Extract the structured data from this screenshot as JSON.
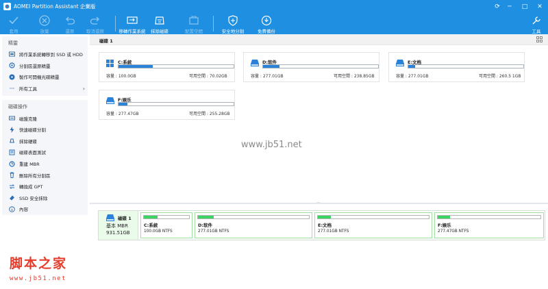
{
  "window": {
    "title": "AOMEI Partition Assistant 企業版"
  },
  "toolbar": {
    "apply": "套用",
    "discard": "放棄",
    "undo": "還原",
    "redo": "取消還原",
    "migrate": "移轉作業系統",
    "wipe": "抹除磁碟",
    "free_space": "配置空間",
    "secure_erase": "安全地分割",
    "free_backup": "免費備份",
    "tools": "工具"
  },
  "sidebar": {
    "wizards_title": "精靈",
    "wizards": [
      {
        "label": "將作業系統轉移到 SSD 或 HDD",
        "icon": "migrate-os-icon"
      },
      {
        "label": "分割區還原精靈",
        "icon": "partition-recovery-icon"
      },
      {
        "label": "製作可開機光碟精靈",
        "icon": "bootable-media-icon"
      },
      {
        "label": "所有工具",
        "icon": "more-icon"
      }
    ],
    "ops_title": "磁碟操作",
    "ops": [
      {
        "label": "磁盤克隆",
        "icon": "clone-disk-icon"
      },
      {
        "label": "快速磁碟分割",
        "icon": "quick-partition-icon"
      },
      {
        "label": "抹除硬碟",
        "icon": "wipe-disk-icon"
      },
      {
        "label": "磁碟表面測試",
        "icon": "surface-test-icon"
      },
      {
        "label": "重建 MBR",
        "icon": "rebuild-mbr-icon"
      },
      {
        "label": "刪除所有分割區",
        "icon": "delete-partitions-icon"
      },
      {
        "label": "轉換成 GPT",
        "icon": "convert-gpt-icon"
      },
      {
        "label": "SSD 安全抹除",
        "icon": "ssd-erase-icon"
      },
      {
        "label": "內容",
        "icon": "properties-icon"
      }
    ]
  },
  "disk": {
    "title": "磁碟 1",
    "type": "基本 MBR",
    "size": "931.51GB"
  },
  "partitions": [
    {
      "name": "C:系統",
      "capacity_label": "容量 : 100.0GB",
      "free_label": "可用空間 : 70.02GB",
      "used": 0.3,
      "map_size": "100.0GB NTFS"
    },
    {
      "name": "D:软件",
      "capacity_label": "容量 : 277.01GB",
      "free_label": "可用空間 : 238.85GB",
      "used": 0.14,
      "map_size": "277.01GB NTFS"
    },
    {
      "name": "E:文档",
      "capacity_label": "容量 : 277.01GB",
      "free_label": "可用空間 : 260.5 1GB",
      "used": 0.06,
      "map_size": "277.01GB NTFS"
    },
    {
      "name": "F:娱乐",
      "capacity_label": "容量 : 277.47GB",
      "free_label": "可用空間 : 255.28GB",
      "used": 0.08,
      "map_size": "277.47GB NTFS"
    }
  ],
  "watermark": "www.jb51.net",
  "logo": {
    "text": "脚本之家",
    "url": "www.jb51.net"
  },
  "colors": {
    "accent": "#1e8fe1",
    "bar_fill": "#2b82d9",
    "map_fill": "#3cd463"
  }
}
